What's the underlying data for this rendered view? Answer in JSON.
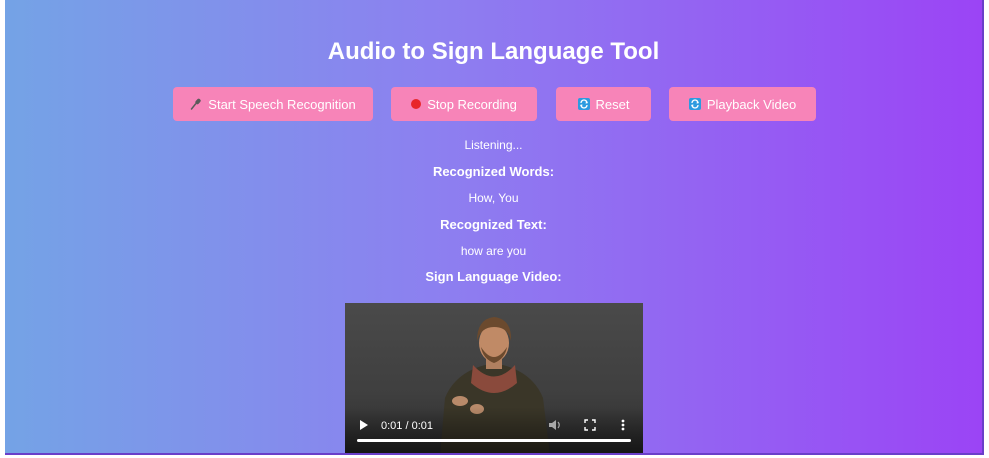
{
  "app": {
    "title": "Audio to Sign Language Tool"
  },
  "toolbar": {
    "start_label": "Start Speech Recognition",
    "stop_label": "Stop Recording",
    "reset_label": "Reset",
    "playback_label": "Playback Video"
  },
  "status": {
    "text": "Listening..."
  },
  "recognized_words": {
    "heading": "Recognized Words:",
    "value": "How, You"
  },
  "recognized_text": {
    "heading": "Recognized Text:",
    "value": "how are you"
  },
  "sign_video": {
    "heading": "Sign Language Video:",
    "time": "0:01 / 0:01",
    "progress": 1.0
  },
  "colors": {
    "gradient_start": "#74a3e6",
    "gradient_end": "#9b44f5",
    "button": "#f784b8",
    "record_dot": "#e8262a",
    "icon_blue": "#2d9be0"
  },
  "icons": {
    "start": "microphone-icon",
    "stop": "red-circle-icon",
    "reset": "refresh-icon",
    "playback": "refresh-icon"
  }
}
